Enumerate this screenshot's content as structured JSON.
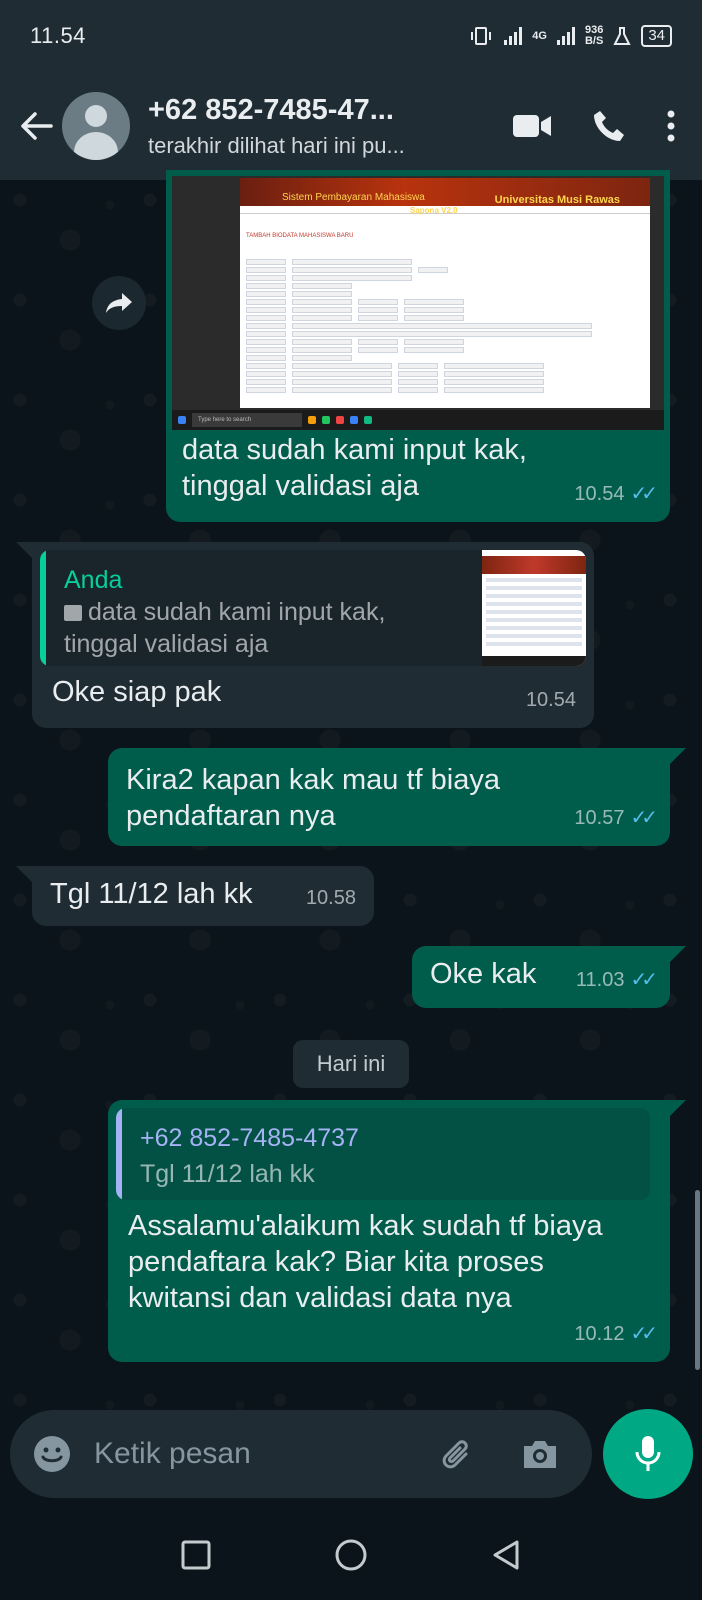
{
  "status": {
    "time": "11.54",
    "network": "4G",
    "speed_value": "936",
    "speed_unit": "B/S",
    "battery": "34"
  },
  "header": {
    "contact_name": "+62 852-7485-47...",
    "last_seen": "terakhir dilihat hari ini pu..."
  },
  "messages": {
    "m1": {
      "screenshot": {
        "banner_left": "Sistem Pembayaran Mahasiswa",
        "banner_right": "Universitas Musi Rawas",
        "banner_sub": "Sapona V2.0",
        "form_title": "TAMBAH BIODATA MAHASISWA BARU",
        "taskbar_search": "Type here to search"
      },
      "text": "data sudah kami input kak, tinggal validasi aja",
      "time": "10.54"
    },
    "m2": {
      "quote_name": "Anda",
      "quote_text": "data sudah kami input kak, tinggal validasi aja",
      "text": "Oke siap pak",
      "time": "10.54"
    },
    "m3": {
      "text": "Kira2 kapan kak mau tf biaya pendaftaran nya",
      "time": "10.57"
    },
    "m4": {
      "text": "Tgl 11/12 lah kk",
      "time": "10.58"
    },
    "m5": {
      "text": "Oke kak",
      "time": "11.03"
    },
    "date_chip": "Hari ini",
    "m6": {
      "quote_name": "+62 852-7485-4737",
      "quote_text": "Tgl 11/12 lah kk",
      "text": "Assalamu'alaikum kak sudah tf biaya pendaftara kak? Biar kita proses kwitansi dan validasi data nya",
      "time": "10.12"
    }
  },
  "composer": {
    "placeholder": "Ketik pesan"
  },
  "colors": {
    "background": "#0b141a",
    "bar": "#1f2c34",
    "outgoing_bubble": "#005c4b",
    "incoming_bubble": "#1f2c34",
    "accent": "#00a884",
    "read_ticks": "#53bdeb"
  },
  "icons": {
    "back": "arrow-left-icon",
    "video": "video-call-icon",
    "call": "phone-icon",
    "menu": "more-vert-icon",
    "forward": "forward-icon",
    "emoji": "emoji-icon",
    "attach": "paperclip-icon",
    "camera": "camera-icon",
    "mic": "mic-icon"
  }
}
